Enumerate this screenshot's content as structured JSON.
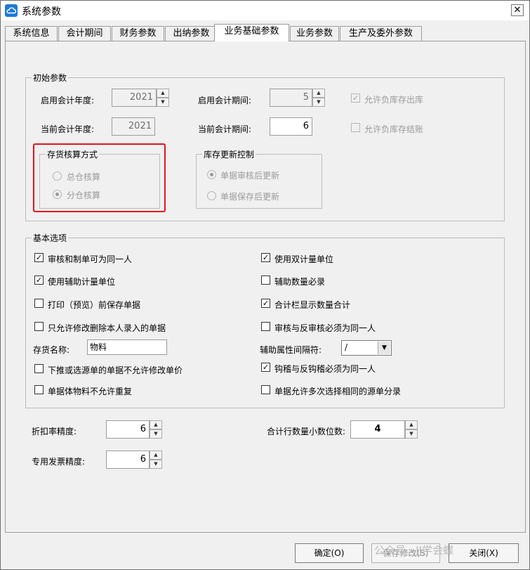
{
  "window": {
    "title": "系统参数",
    "close_glyph": "✕"
  },
  "tabs": [
    {
      "label": "系统信息",
      "active": false
    },
    {
      "label": "会计期间",
      "active": false
    },
    {
      "label": "财务参数",
      "active": false
    },
    {
      "label": "出纳参数",
      "active": false
    },
    {
      "label": "业务基础参数",
      "active": true
    },
    {
      "label": "业务参数",
      "active": false
    },
    {
      "label": "生产及委外参数",
      "active": false
    }
  ],
  "initial_params": {
    "legend": "初始参数",
    "start_year_label": "启用会计年度:",
    "start_year_value": "2021",
    "start_period_label": "启用会计期间:",
    "start_period_value": "5",
    "current_year_label": "当前会计年度:",
    "current_year_value": "2021",
    "current_period_label": "当前会计期间:",
    "current_period_value": "6",
    "allow_negative_out_label": "允许负库存出库",
    "allow_negative_out_checked": true,
    "allow_negative_close_label": "允许负库存结账",
    "allow_negative_close_checked": false,
    "costing_method": {
      "legend": "存货核算方式",
      "options": [
        "总仓核算",
        "分仓核算"
      ],
      "selected": "分仓核算"
    },
    "inventory_update": {
      "legend": "库存更新控制",
      "options": [
        "单据审核后更新",
        "单据保存后更新"
      ],
      "selected": "单据审核后更新"
    }
  },
  "basic_options": {
    "legend": "基本选项",
    "left": [
      {
        "label": "审核和制单可为同一人",
        "checked": true
      },
      {
        "label": "使用辅助计量单位",
        "checked": true
      },
      {
        "label": "打印（预览）前保存单据",
        "checked": false
      },
      {
        "label": "只允许修改删除本人录入的单据",
        "checked": false
      }
    ],
    "right": [
      {
        "label": "使用双计量单位",
        "checked": true
      },
      {
        "label": "辅助数量必录",
        "checked": false
      },
      {
        "label": "合计栏显示数量合计",
        "checked": true
      },
      {
        "label": "审核与反审核必须为同一人",
        "checked": false
      }
    ],
    "inventory_name_label": "存货名称:",
    "inventory_name_value": "物料",
    "aux_separator_label": "辅助属性间隔符:",
    "aux_separator_value": "/",
    "left2": [
      {
        "label": "下推或选源单的单据不允许修改单价",
        "checked": false
      },
      {
        "label": "单据体物料不允许重复",
        "checked": false
      }
    ],
    "right2": [
      {
        "label": "钩稽与反钩稽必须为同一人",
        "checked": true
      },
      {
        "label": "单据允许多次选择相同的源单分录",
        "checked": false
      }
    ]
  },
  "precision": {
    "discount_label": "折扣率精度:",
    "discount_value": "6",
    "total_qty_decimals_label": "合计行数量小数位数:",
    "total_qty_decimals_value": "4",
    "invoice_label": "专用发票精度:",
    "invoice_value": "6"
  },
  "buttons": {
    "ok": "确定(O)",
    "save": "保存修改(S)",
    "close": "关闭(X)"
  },
  "watermark": "公众号 · JJ学会蝶"
}
